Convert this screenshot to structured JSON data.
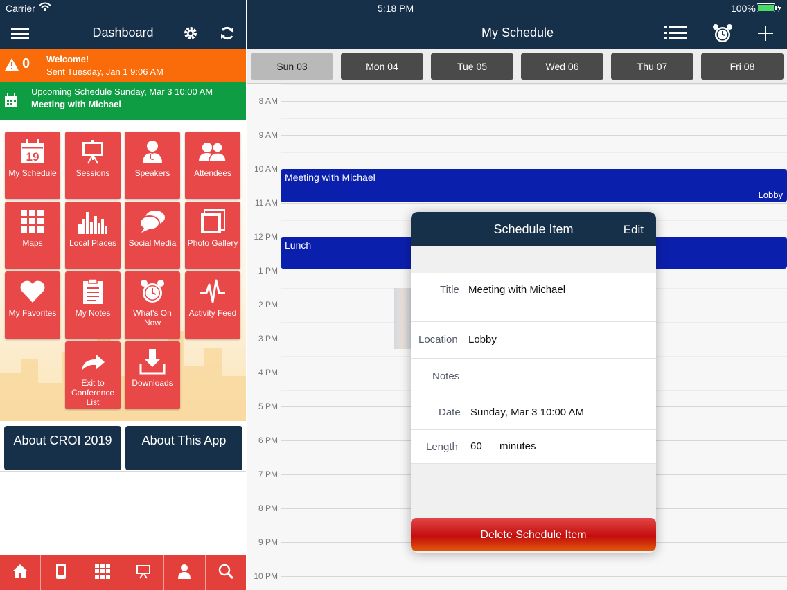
{
  "status_bar": {
    "carrier": "Carrier",
    "time": "5:18 PM",
    "battery": "100%"
  },
  "left_header": {
    "title": "Dashboard"
  },
  "alert": {
    "count": "0",
    "title": "Welcome!",
    "subtitle": "Sent Tuesday, Jan 1 9:06 AM"
  },
  "upcoming": {
    "line1": "Upcoming Schedule Sunday, Mar 3 10:00 AM",
    "line2": "Meeting with Michael"
  },
  "tiles": [
    {
      "label": "My Schedule",
      "icon": "calendar-icon",
      "cal_num": "19"
    },
    {
      "label": "Sessions",
      "icon": "presentation-icon"
    },
    {
      "label": "Speakers",
      "icon": "speaker-icon"
    },
    {
      "label": "Attendees",
      "icon": "attendees-icon"
    },
    {
      "label": "Maps",
      "icon": "map-grid-icon"
    },
    {
      "label": "Local Places",
      "icon": "city-icon"
    },
    {
      "label": "Social Media",
      "icon": "chat-bubbles-icon"
    },
    {
      "label": "Photo Gallery",
      "icon": "photos-icon"
    },
    {
      "label": "My Favorites",
      "icon": "heart-icon"
    },
    {
      "label": "My Notes",
      "icon": "notes-icon"
    },
    {
      "label": "What's On Now",
      "icon": "alarm-clock-icon"
    },
    {
      "label": "Activity Feed",
      "icon": "activity-icon"
    },
    {
      "label": "Exit to Conference List",
      "icon": "exit-arrow-icon"
    },
    {
      "label": "Downloads",
      "icon": "download-icon"
    }
  ],
  "about": {
    "croi": "About CROI 2019",
    "app": "About This App"
  },
  "right_header": {
    "title": "My Schedule"
  },
  "days": [
    "Sun 03",
    "Mon 04",
    "Tue 05",
    "Wed 06",
    "Thu 07",
    "Fri 08"
  ],
  "hours": [
    "8 AM",
    "9 AM",
    "10 AM",
    "11 AM",
    "12 PM",
    "1 PM",
    "2 PM",
    "3 PM",
    "4 PM",
    "5 PM",
    "6 PM",
    "7 PM",
    "8 PM",
    "9 PM",
    "10 PM"
  ],
  "events": [
    {
      "title": "Meeting with Michael",
      "location": "Lobby"
    },
    {
      "title": "Lunch",
      "location": ""
    }
  ],
  "popover": {
    "title": "Schedule Item",
    "edit": "Edit",
    "title_label": "Title",
    "title_value": "Meeting with Michael",
    "location_label": "Location",
    "location_value": "Lobby",
    "notes_label": "Notes",
    "date_label": "Date",
    "date_value": "Sunday, Mar 3 10:00 AM",
    "length_label": "Length",
    "length_value": "60",
    "length_unit": "minutes",
    "delete": "Delete Schedule Item"
  }
}
